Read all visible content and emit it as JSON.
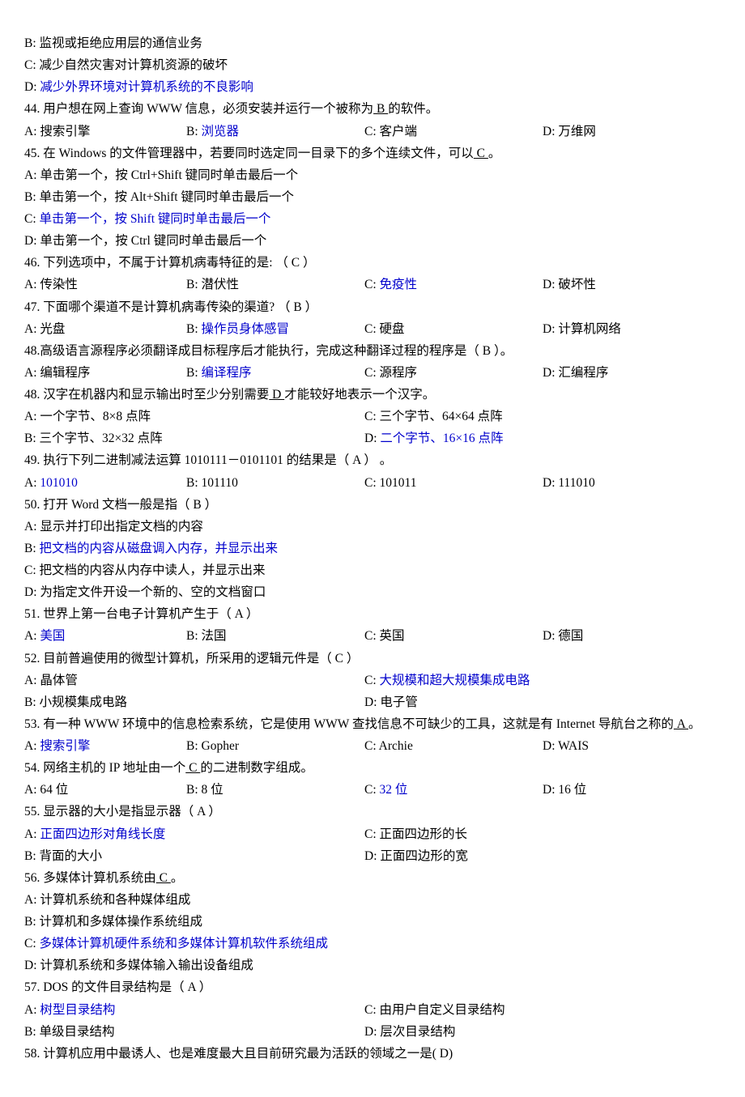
{
  "q43": {
    "B": "B: 监视或拒绝应用层的通信业务",
    "C": "C: 减少自然灾害对计算机资源的破坏",
    "D_pre": "D: ",
    "D_ans": "减少外界环境对计算机系统的不良影响"
  },
  "q44": {
    "stem1": "44. 用户想在网上查询 WWW 信息，必须安装并运行一个被称为",
    "blank": "  B  ",
    "stem2": "的软件。",
    "A": "A: 搜索引擎",
    "B_pre": "B: ",
    "B_ans": "浏览器",
    "C": "C: 客户端",
    "D": "D: 万维网"
  },
  "q45": {
    "stem1": "45. 在 Windows 的文件管理器中，若要同时选定同一目录下的多个连续文件，可以",
    "blank": " C  ",
    "stem2": "。",
    "A": "A: 单击第一个，按 Ctrl+Shift 键同时单击最后一个",
    "B": "B: 单击第一个，按 Alt+Shift 键同时单击最后一个",
    "C_pre": "C: ",
    "C_ans": "单击第一个，按 Shift 键同时单击最后一个",
    "D": "D: 单击第一个，按 Ctrl 键同时单击最后一个"
  },
  "q46": {
    "stem": "46. 下列选项中，不属于计算机病毒特征的是: （ C ）",
    "A": "A: 传染性",
    "B": "B: 潜伏性",
    "C_pre": "C: ",
    "C_ans": "免疫性",
    "D": "D: 破坏性"
  },
  "q47": {
    "stem": "47. 下面哪个渠道不是计算机病毒传染的渠道? （ B ）",
    "A": "A: 光盘",
    "B_pre": "B: ",
    "B_ans": "操作员身体感冒",
    "C": "C: 硬盘",
    "D": "D: 计算机网络"
  },
  "q48a": {
    "stem": "48.高级语言源程序必须翻译成目标程序后才能执行，完成这种翻译过程的程序是（   B   ）。",
    "A": "A: 编辑程序",
    "B_pre": "B: ",
    "B_ans": "编译程序",
    "C": "C: 源程序",
    "D": "D: 汇编程序"
  },
  "q48b": {
    "stem1": "48. 汉字在机器内和显示输出时至少分别需要",
    "blank": " D ",
    "stem2": "才能较好地表示一个汉字。",
    "A": "A: 一个字节、8×8 点阵",
    "B": "B: 三个字节、32×32 点阵",
    "C": "C: 三个字节、64×64 点阵",
    "D_pre": "D: ",
    "D_ans": "二个字节、16×16 点阵"
  },
  "q49": {
    "stem": "49. 执行下列二进制减法运算 1010111－0101101  的结果是（  A   ） 。",
    "A_pre": "A: ",
    "A_ans": "101010",
    "B": "B: 101110",
    "C": "C: 101011",
    "D": "D: 111010"
  },
  "q50": {
    "stem": "50. 打开 Word 文档一般是指（ B ）",
    "A": "A: 显示并打印出指定文档的内容",
    "B_pre": "B: ",
    "B_ans": "把文档的内容从磁盘调入内存，并显示出来",
    "C": "C: 把文档的内容从内存中读人，并显示出来",
    "D": "D: 为指定文件开设一个新的、空的文档窗口"
  },
  "q51": {
    "stem": "51. 世界上第一台电子计算机产生于（ A ）",
    "A_pre": "A: ",
    "A_ans": "美国",
    "B": "B: 法国",
    "C": "C: 英国",
    "D": "D: 德国"
  },
  "q52": {
    "stem": "52. 目前普遍使用的微型计算机，所采用的逻辑元件是（ C ）",
    "A": "A: 晶体管",
    "B": "B: 小规模集成电路",
    "C_pre": "C: ",
    "C_ans": "大规模和超大规模集成电路",
    "D": "D: 电子管"
  },
  "q53": {
    "stem1": "53. 有一种 WWW 环境中的信息检索系统，它是使用 WWW 查找信息不可缺少的工具，这就是有 Internet 导航台之称的",
    "blank": "  A  ",
    "stem2": "。",
    "A_pre": "A: ",
    "A_ans": "搜索引擎",
    "B": "B: Gopher",
    "C": "C: Archie",
    "D": "D: WAIS"
  },
  "q54": {
    "stem1": "54. 网络主机的 IP 地址由一个",
    "blank": "  C  ",
    "stem2": "的二进制数字组成。",
    "A": "A: 64 位",
    "B": "B: 8 位",
    "C_pre": "C: ",
    "C_ans": "32 位",
    "D": "D: 16 位"
  },
  "q55": {
    "stem": "55. 显示器的大小是指显示器（  A ）",
    "A_pre": "A: ",
    "A_ans": "正面四边形对角线长度",
    "B": "B: 背面的大小",
    "C": "C: 正面四边形的长",
    "D": "D: 正面四边形的宽"
  },
  "q56": {
    "stem1": "56. 多媒体计算机系统由",
    "blank": "  C  ",
    "stem2": "。",
    "A": "A: 计算机系统和各种媒体组成",
    "B": "B: 计算机和多媒体操作系统组成",
    "C_pre": "C: ",
    "C_ans": "多媒体计算机硬件系统和多媒体计算机软件系统组成",
    "D": "D: 计算机系统和多媒体输入输出设备组成"
  },
  "q57": {
    "stem": "57. DOS 的文件目录结构是（ A ）",
    "A_pre": "A: ",
    "A_ans": "树型目录结构",
    "B": "B: 单级目录结构",
    "C": "C: 由用户自定义目录结构",
    "D": "D: 层次目录结构"
  },
  "q58": {
    "stem": "58. 计算机应用中最诱人、也是难度最大且目前研究最为活跃的领域之一是( D)"
  }
}
